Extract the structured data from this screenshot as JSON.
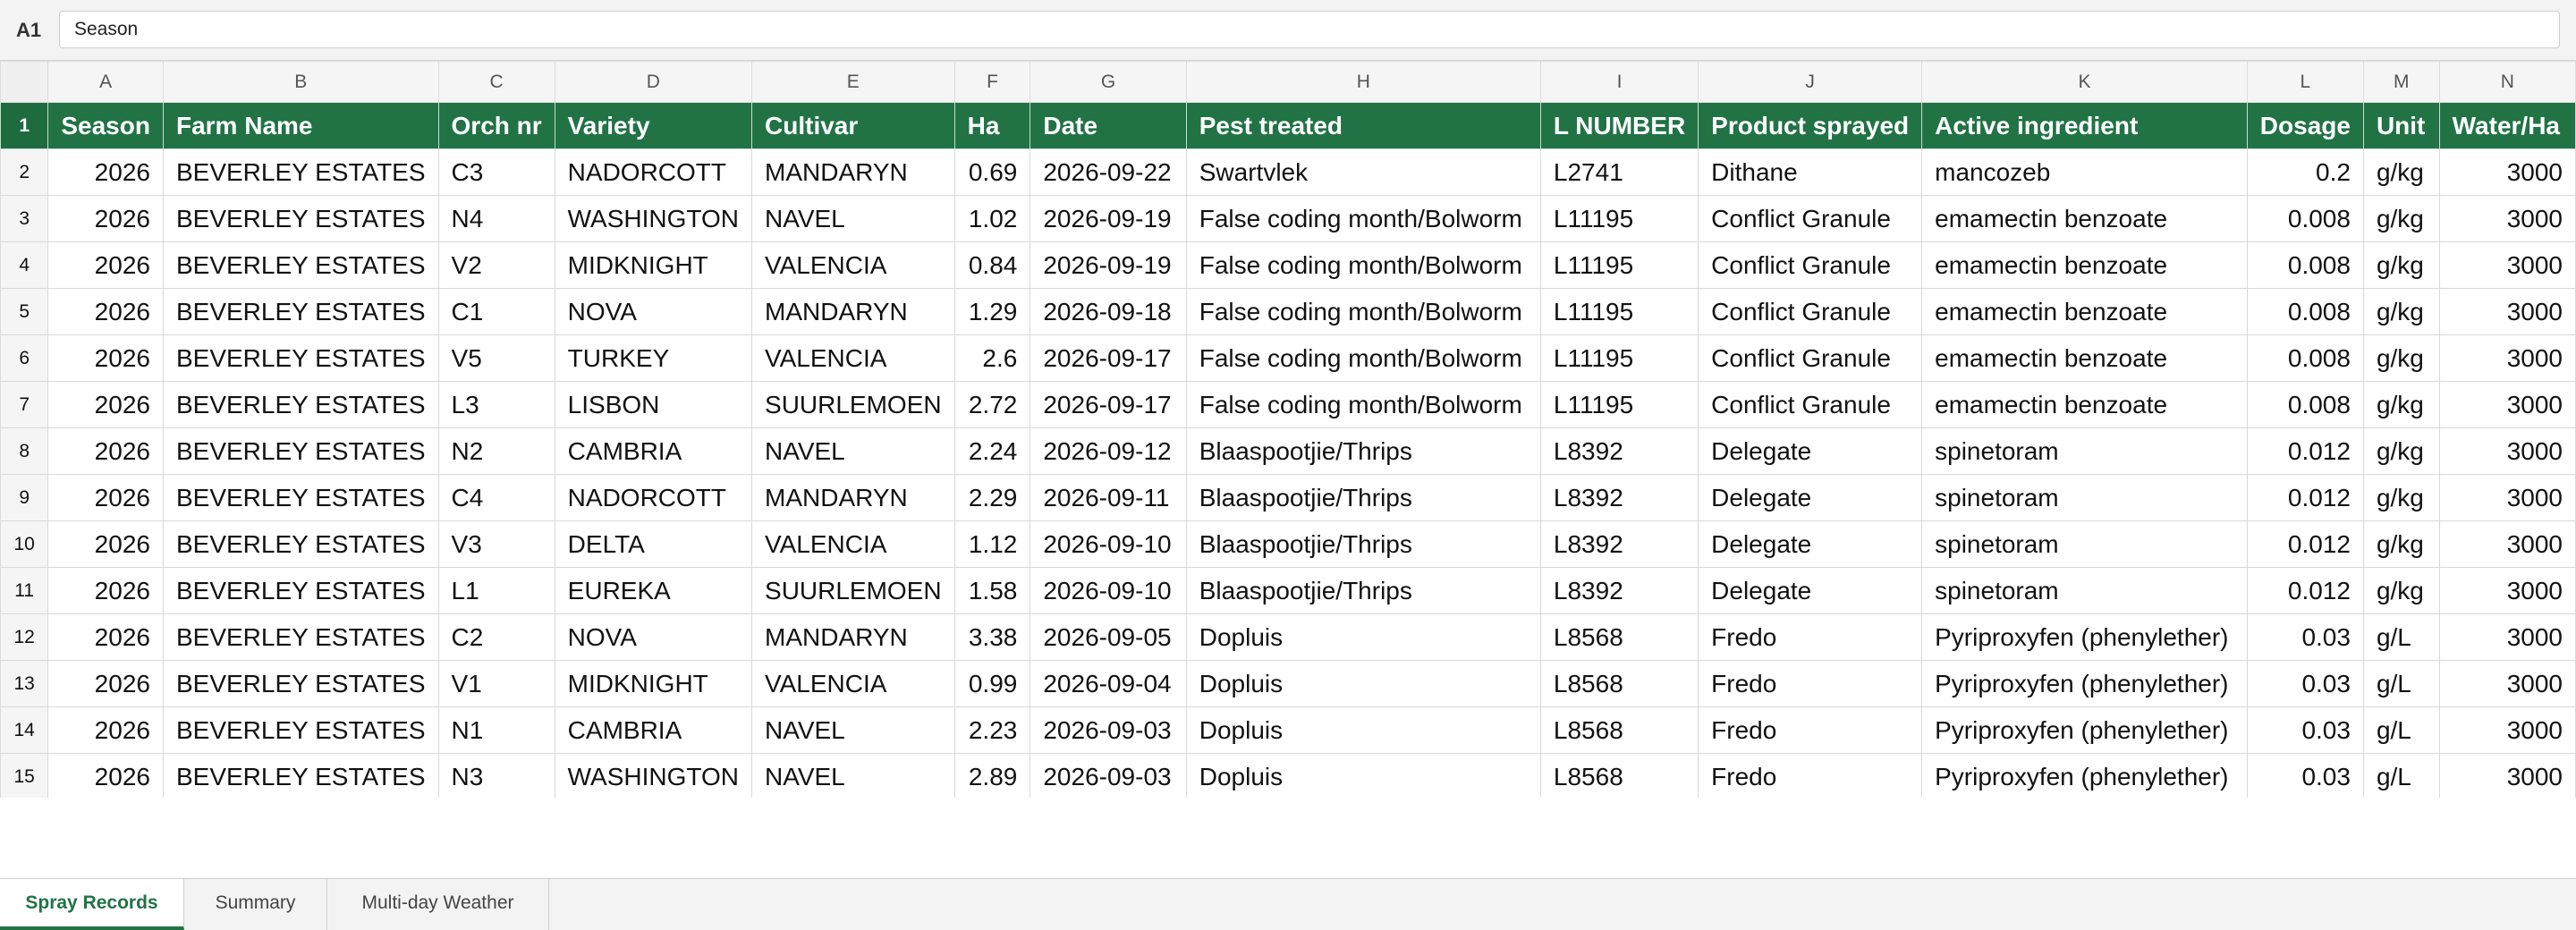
{
  "formula_bar": {
    "cell_ref": "A1",
    "value": "Season"
  },
  "columns": [
    "A",
    "B",
    "C",
    "D",
    "E",
    "F",
    "G",
    "H",
    "I",
    "J",
    "K",
    "L",
    "M",
    "N"
  ],
  "headers": [
    "Season",
    "Farm Name",
    "Orch nr",
    "Variety",
    "Cultivar",
    "Ha",
    "Date",
    "Pest treated",
    "L NUMBER",
    "Product sprayed",
    "Active ingredient",
    "Dosage",
    "Unit",
    "Water/Ha"
  ],
  "rows": [
    {
      "n": "2",
      "cells": [
        "2026",
        "BEVERLEY ESTATES",
        "C3",
        "NADORCOTT",
        "MANDARYN",
        "0.69",
        "2026-09-22",
        "Swartvlek",
        "L2741",
        "Dithane",
        "mancozeb",
        "0.2",
        "g/kg",
        "3000"
      ]
    },
    {
      "n": "3",
      "cells": [
        "2026",
        "BEVERLEY ESTATES",
        "N4",
        "WASHINGTON",
        "NAVEL",
        "1.02",
        "2026-09-19",
        "False coding month/Bolworm",
        "L11195",
        "Conflict Granule",
        "emamectin benzoate",
        "0.008",
        "g/kg",
        "3000"
      ]
    },
    {
      "n": "4",
      "cells": [
        "2026",
        "BEVERLEY ESTATES",
        "V2",
        "MIDKNIGHT",
        "VALENCIA",
        "0.84",
        "2026-09-19",
        "False coding month/Bolworm",
        "L11195",
        "Conflict Granule",
        "emamectin benzoate",
        "0.008",
        "g/kg",
        "3000"
      ]
    },
    {
      "n": "5",
      "cells": [
        "2026",
        "BEVERLEY ESTATES",
        "C1",
        "NOVA",
        "MANDARYN",
        "1.29",
        "2026-09-18",
        "False coding month/Bolworm",
        "L11195",
        "Conflict Granule",
        "emamectin benzoate",
        "0.008",
        "g/kg",
        "3000"
      ]
    },
    {
      "n": "6",
      "cells": [
        "2026",
        "BEVERLEY ESTATES",
        "V5",
        "TURKEY",
        "VALENCIA",
        "2.6",
        "2026-09-17",
        "False coding month/Bolworm",
        "L11195",
        "Conflict Granule",
        "emamectin benzoate",
        "0.008",
        "g/kg",
        "3000"
      ]
    },
    {
      "n": "7",
      "cells": [
        "2026",
        "BEVERLEY ESTATES",
        "L3",
        "LISBON",
        "SUURLEMOEN",
        "2.72",
        "2026-09-17",
        "False coding month/Bolworm",
        "L11195",
        "Conflict Granule",
        "emamectin benzoate",
        "0.008",
        "g/kg",
        "3000"
      ]
    },
    {
      "n": "8",
      "cells": [
        "2026",
        "BEVERLEY ESTATES",
        "N2",
        "CAMBRIA",
        "NAVEL",
        "2.24",
        "2026-09-12",
        "Blaaspootjie/Thrips",
        "L8392",
        "Delegate",
        "spinetoram",
        "0.012",
        "g/kg",
        "3000"
      ]
    },
    {
      "n": "9",
      "cells": [
        "2026",
        "BEVERLEY ESTATES",
        "C4",
        "NADORCOTT",
        "MANDARYN",
        "2.29",
        "2026-09-11",
        "Blaaspootjie/Thrips",
        "L8392",
        "Delegate",
        "spinetoram",
        "0.012",
        "g/kg",
        "3000"
      ]
    },
    {
      "n": "10",
      "cells": [
        "2026",
        "BEVERLEY ESTATES",
        "V3",
        "DELTA",
        "VALENCIA",
        "1.12",
        "2026-09-10",
        "Blaaspootjie/Thrips",
        "L8392",
        "Delegate",
        "spinetoram",
        "0.012",
        "g/kg",
        "3000"
      ]
    },
    {
      "n": "11",
      "cells": [
        "2026",
        "BEVERLEY ESTATES",
        "L1",
        "EUREKA",
        "SUURLEMOEN",
        "1.58",
        "2026-09-10",
        "Blaaspootjie/Thrips",
        "L8392",
        "Delegate",
        "spinetoram",
        "0.012",
        "g/kg",
        "3000"
      ]
    },
    {
      "n": "12",
      "cells": [
        "2026",
        "BEVERLEY ESTATES",
        "C2",
        "NOVA",
        "MANDARYN",
        "3.38",
        "2026-09-05",
        "Dopluis",
        "L8568",
        "Fredo",
        "Pyriproxyfen (phenylether)",
        "0.03",
        "g/L",
        "3000"
      ]
    },
    {
      "n": "13",
      "cells": [
        "2026",
        "BEVERLEY ESTATES",
        "V1",
        "MIDKNIGHT",
        "VALENCIA",
        "0.99",
        "2026-09-04",
        "Dopluis",
        "L8568",
        "Fredo",
        "Pyriproxyfen (phenylether)",
        "0.03",
        "g/L",
        "3000"
      ]
    },
    {
      "n": "14",
      "cells": [
        "2026",
        "BEVERLEY ESTATES",
        "N1",
        "CAMBRIA",
        "NAVEL",
        "2.23",
        "2026-09-03",
        "Dopluis",
        "L8568",
        "Fredo",
        "Pyriproxyfen (phenylether)",
        "0.03",
        "g/L",
        "3000"
      ]
    },
    {
      "n": "15",
      "cells": [
        "2026",
        "BEVERLEY ESTATES",
        "N3",
        "WASHINGTON",
        "NAVEL",
        "2.89",
        "2026-09-03",
        "Dopluis",
        "L8568",
        "Fredo",
        "Pyriproxyfen (phenylether)",
        "0.03",
        "g/L",
        "3000"
      ]
    }
  ],
  "sheet_tabs": [
    {
      "label": "Spray Records",
      "active": true
    },
    {
      "label": "Summary",
      "active": false
    },
    {
      "label": "Multi-day Weather",
      "active": false
    }
  ],
  "colors": {
    "header_green": "#217346"
  }
}
